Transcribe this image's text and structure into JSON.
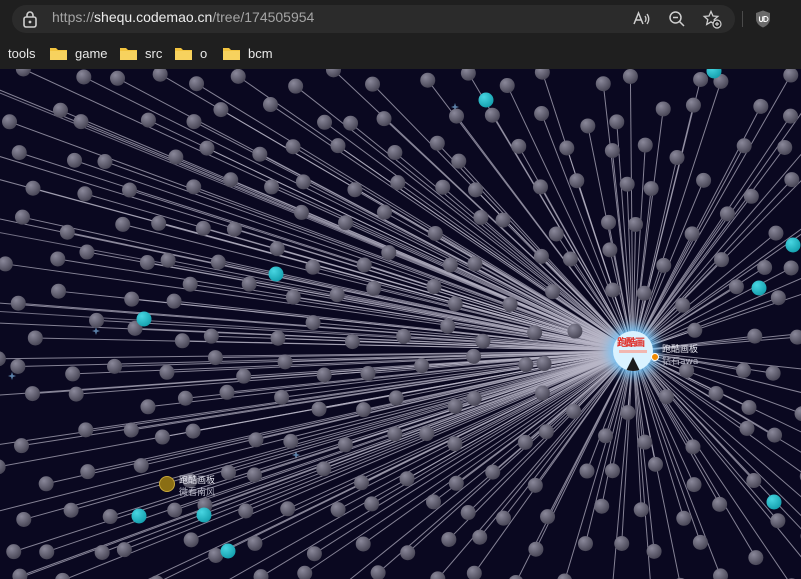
{
  "browser": {
    "url": {
      "scheme": "https://",
      "host": "shequ.codemao.cn",
      "path": "/tree/174505954"
    },
    "toolbar_icons": [
      "lock-icon",
      "read-aloud-icon",
      "zoom-out-icon",
      "add-favorite-icon",
      "extension-ublock-icon"
    ],
    "bookmarks": [
      {
        "label": "tools",
        "icon": null
      },
      {
        "label": "game",
        "icon": "folder-icon"
      },
      {
        "label": "src",
        "icon": "folder-icon"
      },
      {
        "label": "o",
        "icon": "folder-icon"
      },
      {
        "label": "bcm",
        "icon": "folder-icon"
      }
    ]
  },
  "tree": {
    "root": {
      "avatar_text": "跑酷画",
      "title": "跑酷画板",
      "author": "钻石awa"
    },
    "labeled_node": {
      "title": "跑酷画板",
      "author": "微看南风"
    }
  },
  "colors": {
    "background": "#0a0820",
    "node": "#4a4858",
    "highlight_node": "#16a2b0",
    "edge": "#b9b6c8",
    "labeled_node": "#8a6e14"
  }
}
